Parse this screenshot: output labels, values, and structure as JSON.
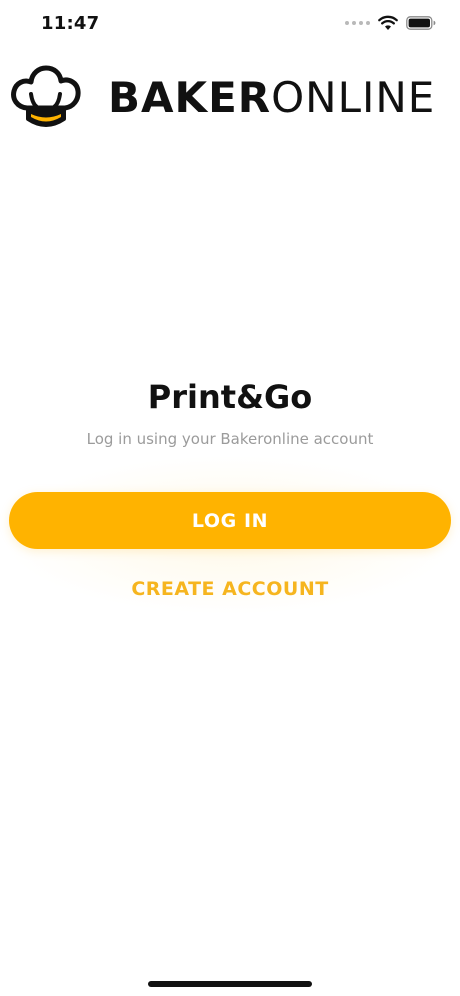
{
  "status_bar": {
    "time": "11:47",
    "icons": [
      "signal-dots-icon",
      "wifi-icon",
      "battery-icon"
    ]
  },
  "logo": {
    "text_bold": "BAKER",
    "text_light": "ONLINE",
    "icon": "chef-hat-icon"
  },
  "main": {
    "title": "Print&Go",
    "subtitle": "Log in using your Bakeronline account",
    "login_label": "LOG IN",
    "create_account_label": "CREATE ACCOUNT"
  },
  "colors": {
    "accent": "#FFB300",
    "accent_text": "#F6B51F",
    "text_primary": "#111111",
    "text_secondary": "#9B9B9B"
  }
}
